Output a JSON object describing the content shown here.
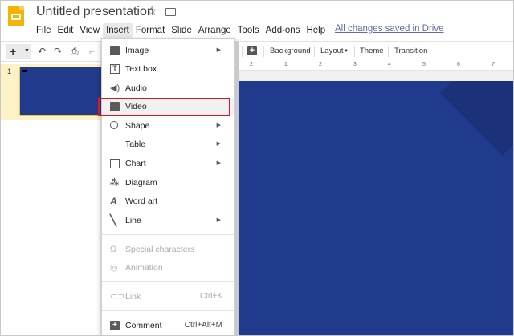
{
  "title_bar": {
    "doc_title": "Untitled presentation",
    "star_icon": "star-outline",
    "folder_icon": "move-to-folder"
  },
  "menu_bar": {
    "items": [
      "File",
      "Edit",
      "View",
      "Insert",
      "Format",
      "Slide",
      "Arrange",
      "Tools",
      "Add-ons",
      "Help"
    ],
    "active": "Insert",
    "saved_status": "All changes saved in Drive"
  },
  "toolbar": {
    "new_slide": "+",
    "buttons": [
      "undo",
      "redo",
      "print",
      "paint-format",
      "new-comment"
    ],
    "background_label": "Background",
    "layout_label": "Layout",
    "theme_label": "Theme",
    "transition_label": "Transition"
  },
  "ruler": {
    "labels": [
      "2",
      "1",
      "2",
      "3",
      "4",
      "5",
      "6",
      "7"
    ]
  },
  "filmstrip": {
    "slide_number": "1"
  },
  "colors": {
    "slide_blue": "#203a8d",
    "filmstrip_selected": "#fdf1c6",
    "highlight_border": "#d8192a",
    "link_blue": "#5f6ba8"
  },
  "insert_menu": {
    "items": [
      {
        "label": "Image",
        "icon": "image-icon",
        "submenu": true
      },
      {
        "label": "Text box",
        "icon": "text-box-icon"
      },
      {
        "label": "Audio",
        "icon": "audio-icon"
      },
      {
        "label": "Video",
        "icon": "video-icon",
        "highlighted": true
      },
      {
        "label": "Shape",
        "icon": "shape-icon",
        "submenu": true
      },
      {
        "label": "Table",
        "submenu": true
      },
      {
        "label": "Chart",
        "icon": "chart-icon",
        "submenu": true
      },
      {
        "label": "Diagram",
        "icon": "diagram-icon"
      },
      {
        "label": "Word art",
        "icon": "word-art-icon"
      },
      {
        "label": "Line",
        "icon": "line-icon",
        "submenu": true
      },
      {
        "label": "Special characters",
        "icon": "omega-icon",
        "disabled": true
      },
      {
        "label": "Animation",
        "icon": "animation-icon",
        "disabled": true
      },
      {
        "label": "Link",
        "icon": "link-icon",
        "disabled": true,
        "shortcut": "Ctrl+K"
      },
      {
        "label": "Comment",
        "icon": "comment-icon",
        "shortcut": "Ctrl+Alt+M"
      }
    ]
  }
}
